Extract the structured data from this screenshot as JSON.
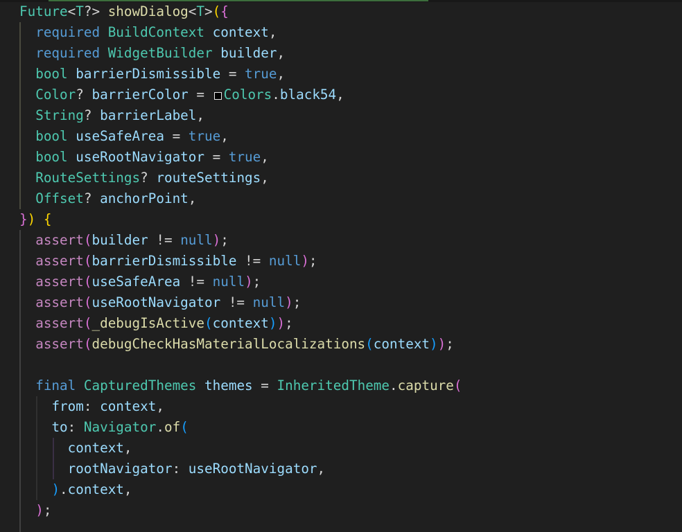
{
  "editor": {
    "language": "dart",
    "theme_colors": {
      "background": "#1f1f1f",
      "type": "#4ec9b0",
      "keyword": "#569cd6",
      "function": "#dcdcaa",
      "variable": "#9cdcfe",
      "control": "#c586c0",
      "plain": "#d4d4d4",
      "bracket_1": "#ffd700",
      "bracket_2": "#da70d6",
      "bracket_3": "#179fff"
    },
    "color_swatch": {
      "icon": "color-swatch-icon",
      "color": "#000000"
    },
    "lines": [
      [
        [
          "ty",
          "Future"
        ],
        [
          "pl",
          "<"
        ],
        [
          "ty",
          "T"
        ],
        [
          "pl",
          "?> "
        ],
        [
          "fn",
          "showDialog"
        ],
        [
          "pl",
          "<"
        ],
        [
          "ty",
          "T"
        ],
        [
          "pl",
          ">"
        ],
        [
          "b1",
          "("
        ],
        [
          "b2",
          "{"
        ]
      ],
      [
        [
          "pl",
          "  "
        ],
        [
          "kw",
          "required"
        ],
        [
          "pl",
          " "
        ],
        [
          "ty",
          "BuildContext"
        ],
        [
          "pl",
          " "
        ],
        [
          "vr",
          "context"
        ],
        [
          "pl",
          ","
        ]
      ],
      [
        [
          "pl",
          "  "
        ],
        [
          "kw",
          "required"
        ],
        [
          "pl",
          " "
        ],
        [
          "ty",
          "WidgetBuilder"
        ],
        [
          "pl",
          " "
        ],
        [
          "vr",
          "builder"
        ],
        [
          "pl",
          ","
        ]
      ],
      [
        [
          "pl",
          "  "
        ],
        [
          "ty",
          "bool"
        ],
        [
          "pl",
          " "
        ],
        [
          "vr",
          "barrierDismissible"
        ],
        [
          "pl",
          " = "
        ],
        [
          "kw",
          "true"
        ],
        [
          "pl",
          ","
        ]
      ],
      [
        [
          "pl",
          "  "
        ],
        [
          "ty",
          "Color"
        ],
        [
          "pl",
          "? "
        ],
        [
          "vr",
          "barrierColor"
        ],
        [
          "pl",
          " = "
        ],
        [
          "swatch",
          ""
        ],
        [
          "ty",
          "Colors"
        ],
        [
          "pl",
          "."
        ],
        [
          "vr",
          "black54"
        ],
        [
          "pl",
          ","
        ]
      ],
      [
        [
          "pl",
          "  "
        ],
        [
          "ty",
          "String"
        ],
        [
          "pl",
          "? "
        ],
        [
          "vr",
          "barrierLabel"
        ],
        [
          "pl",
          ","
        ]
      ],
      [
        [
          "pl",
          "  "
        ],
        [
          "ty",
          "bool"
        ],
        [
          "pl",
          " "
        ],
        [
          "vr",
          "useSafeArea"
        ],
        [
          "pl",
          " = "
        ],
        [
          "kw",
          "true"
        ],
        [
          "pl",
          ","
        ]
      ],
      [
        [
          "pl",
          "  "
        ],
        [
          "ty",
          "bool"
        ],
        [
          "pl",
          " "
        ],
        [
          "vr",
          "useRootNavigator"
        ],
        [
          "pl",
          " = "
        ],
        [
          "kw",
          "true"
        ],
        [
          "pl",
          ","
        ]
      ],
      [
        [
          "pl",
          "  "
        ],
        [
          "ty",
          "RouteSettings"
        ],
        [
          "pl",
          "? "
        ],
        [
          "vr",
          "routeSettings"
        ],
        [
          "pl",
          ","
        ]
      ],
      [
        [
          "pl",
          "  "
        ],
        [
          "ty",
          "Offset"
        ],
        [
          "pl",
          "? "
        ],
        [
          "vr",
          "anchorPoint"
        ],
        [
          "pl",
          ","
        ]
      ],
      [
        [
          "b2",
          "}"
        ],
        [
          "b1",
          ")"
        ],
        [
          "pl",
          " "
        ],
        [
          "b1",
          "{"
        ]
      ],
      [
        [
          "pl",
          "  "
        ],
        [
          "ct",
          "assert"
        ],
        [
          "b2",
          "("
        ],
        [
          "vr",
          "builder"
        ],
        [
          "pl",
          " != "
        ],
        [
          "kw",
          "null"
        ],
        [
          "b2",
          ")"
        ],
        [
          "pl",
          ";"
        ]
      ],
      [
        [
          "pl",
          "  "
        ],
        [
          "ct",
          "assert"
        ],
        [
          "b2",
          "("
        ],
        [
          "vr",
          "barrierDismissible"
        ],
        [
          "pl",
          " != "
        ],
        [
          "kw",
          "null"
        ],
        [
          "b2",
          ")"
        ],
        [
          "pl",
          ";"
        ]
      ],
      [
        [
          "pl",
          "  "
        ],
        [
          "ct",
          "assert"
        ],
        [
          "b2",
          "("
        ],
        [
          "vr",
          "useSafeArea"
        ],
        [
          "pl",
          " != "
        ],
        [
          "kw",
          "null"
        ],
        [
          "b2",
          ")"
        ],
        [
          "pl",
          ";"
        ]
      ],
      [
        [
          "pl",
          "  "
        ],
        [
          "ct",
          "assert"
        ],
        [
          "b2",
          "("
        ],
        [
          "vr",
          "useRootNavigator"
        ],
        [
          "pl",
          " != "
        ],
        [
          "kw",
          "null"
        ],
        [
          "b2",
          ")"
        ],
        [
          "pl",
          ";"
        ]
      ],
      [
        [
          "pl",
          "  "
        ],
        [
          "ct",
          "assert"
        ],
        [
          "b2",
          "("
        ],
        [
          "fn",
          "_debugIsActive"
        ],
        [
          "b3",
          "("
        ],
        [
          "vr",
          "context"
        ],
        [
          "b3",
          ")"
        ],
        [
          "b2",
          ")"
        ],
        [
          "pl",
          ";"
        ]
      ],
      [
        [
          "pl",
          "  "
        ],
        [
          "ct",
          "assert"
        ],
        [
          "b2",
          "("
        ],
        [
          "fn",
          "debugCheckHasMaterialLocalizations"
        ],
        [
          "b3",
          "("
        ],
        [
          "vr",
          "context"
        ],
        [
          "b3",
          ")"
        ],
        [
          "b2",
          ")"
        ],
        [
          "pl",
          ";"
        ]
      ],
      [],
      [
        [
          "pl",
          "  "
        ],
        [
          "kw",
          "final"
        ],
        [
          "pl",
          " "
        ],
        [
          "ty",
          "CapturedThemes"
        ],
        [
          "pl",
          " "
        ],
        [
          "vr",
          "themes"
        ],
        [
          "pl",
          " = "
        ],
        [
          "ty",
          "InheritedTheme"
        ],
        [
          "pl",
          "."
        ],
        [
          "fn",
          "capture"
        ],
        [
          "b2",
          "("
        ]
      ],
      [
        [
          "pl",
          "    "
        ],
        [
          "vr",
          "from"
        ],
        [
          "pl",
          ": "
        ],
        [
          "vr",
          "context"
        ],
        [
          "pl",
          ","
        ]
      ],
      [
        [
          "pl",
          "    "
        ],
        [
          "vr",
          "to"
        ],
        [
          "pl",
          ": "
        ],
        [
          "ty",
          "Navigator"
        ],
        [
          "pl",
          "."
        ],
        [
          "fn",
          "of"
        ],
        [
          "b3",
          "("
        ]
      ],
      [
        [
          "pl",
          "      "
        ],
        [
          "vr",
          "context"
        ],
        [
          "pl",
          ","
        ]
      ],
      [
        [
          "pl",
          "      "
        ],
        [
          "vr",
          "rootNavigator"
        ],
        [
          "pl",
          ": "
        ],
        [
          "vr",
          "useRootNavigator"
        ],
        [
          "pl",
          ","
        ]
      ],
      [
        [
          "pl",
          "    "
        ],
        [
          "b3",
          ")"
        ],
        [
          "pl",
          "."
        ],
        [
          "vr",
          "context"
        ],
        [
          "pl",
          ","
        ]
      ],
      [
        [
          "pl",
          "  "
        ],
        [
          "b2",
          ")"
        ],
        [
          "pl",
          ";"
        ]
      ]
    ]
  }
}
